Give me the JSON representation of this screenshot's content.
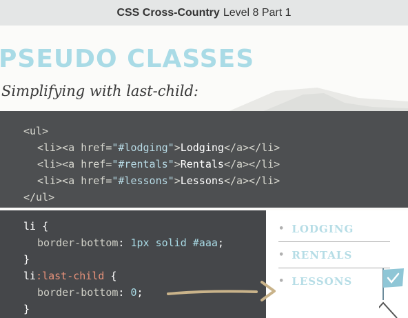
{
  "header": {
    "course": "CSS Cross-Country",
    "section": "Level 8 Part 1"
  },
  "slide": {
    "title": "PSEUDO CLASSES",
    "subtitle": "Simplifying with last-child:"
  },
  "html_code": {
    "ul_open": "<ul>",
    "items": [
      {
        "href": "\"#lodging\"",
        "text": "Lodging"
      },
      {
        "href": "\"#rentals\"",
        "text": "Rentals"
      },
      {
        "href": "\"#lessons\"",
        "text": "Lessons"
      }
    ],
    "li_open": "<li><a href=",
    "a_close_bracket": ">",
    "li_close": "</a></li>",
    "ul_close": "</ul>"
  },
  "css_code": {
    "rule1_selector": "li",
    "rule1_open": " {",
    "rule1_prop": "border-bottom",
    "rule1_value": "1px solid #aaa",
    "close_brace": "}",
    "rule2_selector": "li",
    "rule2_pseudo": ":last-child",
    "rule2_open": " {",
    "rule2_prop": "border-bottom",
    "rule2_value": "0"
  },
  "preview": {
    "items": [
      "LODGING",
      "RENTALS",
      "LESSONS"
    ],
    "bullet": "•"
  },
  "colors": {
    "title": "#a9dbe6",
    "code_bg": "#4d4f51",
    "pseudo": "#e8927a",
    "string": "#b8dbe6",
    "nav_text": "#b6dde6"
  },
  "icons": [
    "flag-icon",
    "arrow-icon",
    "mountain-illustration"
  ]
}
